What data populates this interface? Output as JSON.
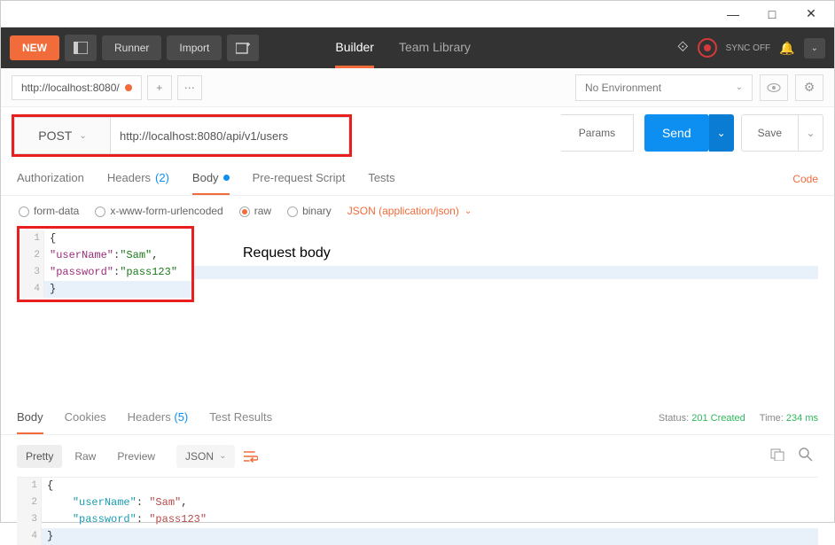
{
  "titlebar": {
    "min": "—",
    "max": "□",
    "close": "✕"
  },
  "topbar": {
    "new": "NEW",
    "runner": "Runner",
    "import": "Import",
    "tabs": {
      "builder": "Builder",
      "teamlib": "Team Library"
    },
    "sync": "SYNC OFF"
  },
  "row2": {
    "tab": "http://localhost:8080/",
    "env": "No Environment"
  },
  "request": {
    "method": "POST",
    "url": "http://localhost:8080/api/v1/users",
    "params": "Params",
    "send": "Send",
    "save": "Save"
  },
  "subtabs": {
    "auth": "Authorization",
    "headers": "Headers",
    "hcount": "(2)",
    "body": "Body",
    "prereq": "Pre-request Script",
    "tests": "Tests",
    "code": "Code"
  },
  "bodytypes": {
    "formdata": "form-data",
    "xform": "x-www-form-urlencoded",
    "raw": "raw",
    "binary": "binary",
    "contenttype": "JSON (application/json)"
  },
  "reqbody": {
    "l1": "{",
    "l2a": "\"userName\"",
    "l2b": ":",
    "l2c": "\"Sam\"",
    "l2d": ",",
    "l3a": "\"password\"",
    "l3b": ":",
    "l3c": "\"pass123\"",
    "l4": "}",
    "annot": "Request body"
  },
  "gutters": {
    "g1": "1",
    "g2": "2",
    "g3": "3",
    "g4": "4"
  },
  "resp": {
    "tabs": {
      "body": "Body",
      "cookies": "Cookies",
      "headers": "Headers",
      "hcount": "(5)",
      "tests": "Test Results"
    },
    "status_lbl": "Status:",
    "status_val": "201 Created",
    "time_lbl": "Time:",
    "time_val": "234 ms",
    "toolbar": {
      "pretty": "Pretty",
      "raw": "Raw",
      "preview": "Preview",
      "fmt": "JSON"
    },
    "body": {
      "l1": "{",
      "l2a": "\"userName\"",
      "l2b": ": ",
      "l2c": "\"Sam\"",
      "l2d": ",",
      "l3a": "\"password\"",
      "l3b": ": ",
      "l3c": "\"pass123\"",
      "l4": "}"
    }
  }
}
